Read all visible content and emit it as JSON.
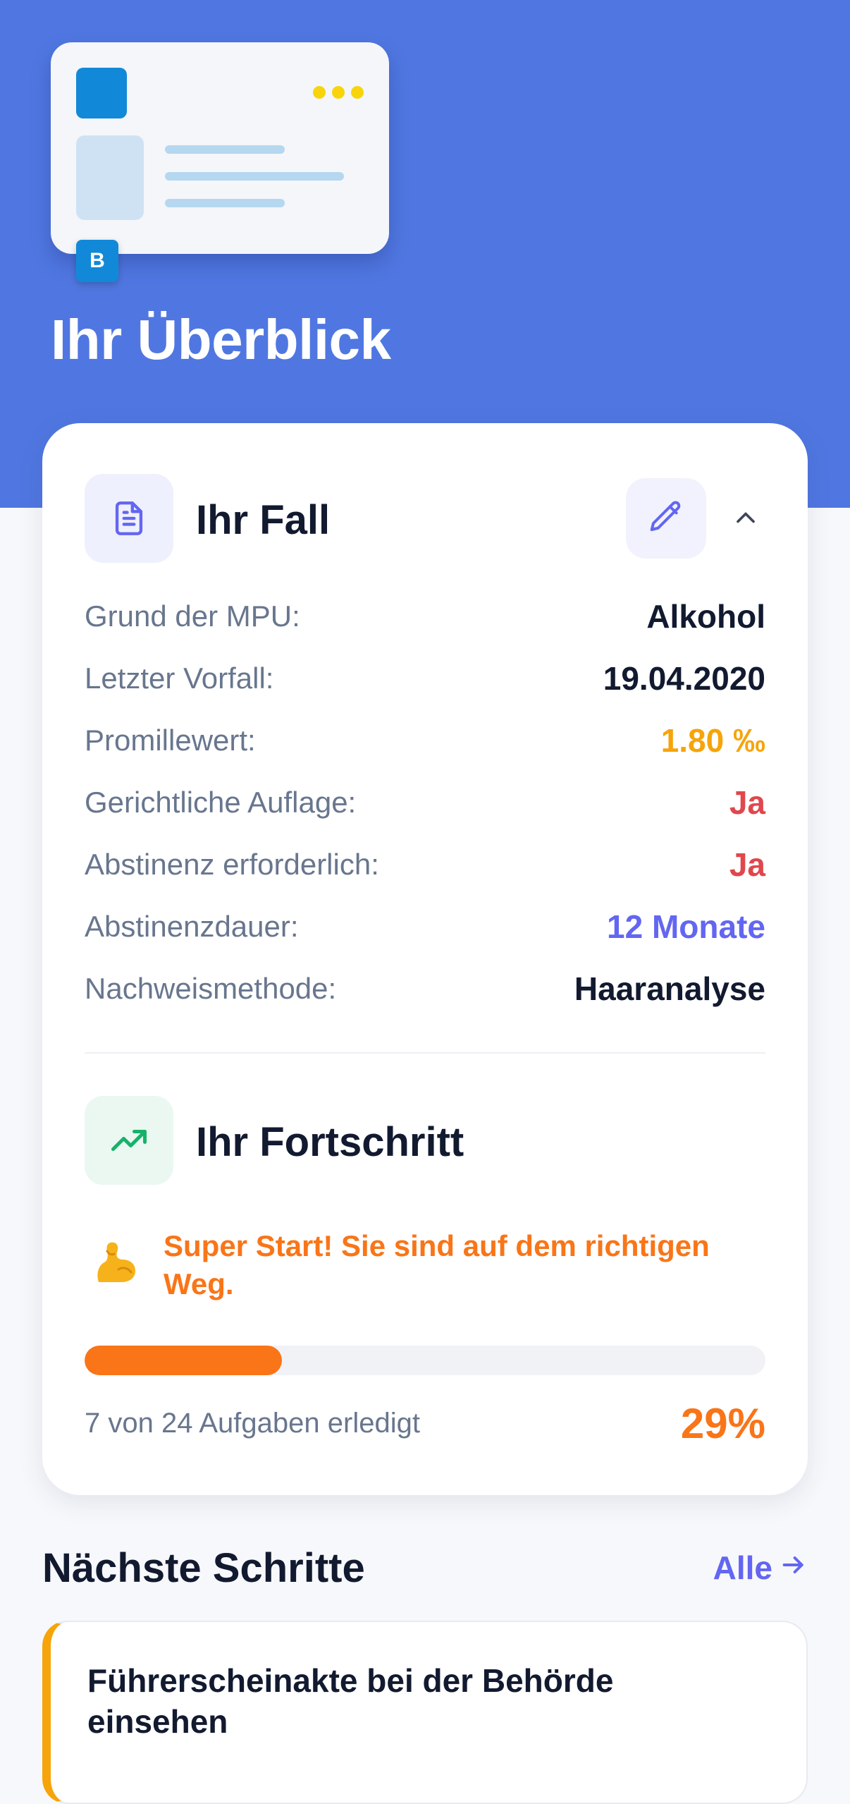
{
  "colors": {
    "hero_bg": "#5077e1",
    "accent_orange": "#f97518",
    "accent_amber": "#f6a40a",
    "accent_red": "#e0474d",
    "accent_indigo": "#6366f1",
    "license_blue": "#1289d8",
    "license_yellow": "#f8d40a"
  },
  "header": {
    "license_badge": "B",
    "title": "Ihr Überblick",
    "illustration_icon": "driver-license-icon"
  },
  "case": {
    "title": "Ihr Fall",
    "icon": "document-icon",
    "edit_icon": "pencil-icon",
    "collapse_icon": "chevron-up-icon",
    "rows": [
      {
        "label": "Grund der MPU:",
        "value": "Alkohol"
      },
      {
        "label": "Letzter Vorfall:",
        "value": "19.04.2020"
      },
      {
        "label": "Promillewert:",
        "value": "1.80 ‰"
      },
      {
        "label": "Gerichtliche Auflage:",
        "value": "Ja"
      },
      {
        "label": "Abstinenz erforderlich:",
        "value": "Ja"
      },
      {
        "label": "Abstinenzdauer:",
        "value": "12 Monate"
      },
      {
        "label": "Nachweismethode:",
        "value": "Haaranalyse"
      }
    ]
  },
  "progress": {
    "title": "Ihr Fortschritt",
    "icon": "trending-up-icon",
    "emoji_icon": "flexed-biceps-icon",
    "message": "Super Start! Sie sind auf dem richtigen Weg.",
    "completed": 7,
    "total": 24,
    "summary": "7 von 24 Aufgaben erledigt",
    "percent_label": "29%",
    "percent": 29
  },
  "next_steps": {
    "title": "Nächste Schritte",
    "all_label": "Alle",
    "arrow_icon": "arrow-right-icon",
    "tasks": [
      {
        "title": "Führerscheinakte bei der Behörde einsehen"
      }
    ]
  }
}
